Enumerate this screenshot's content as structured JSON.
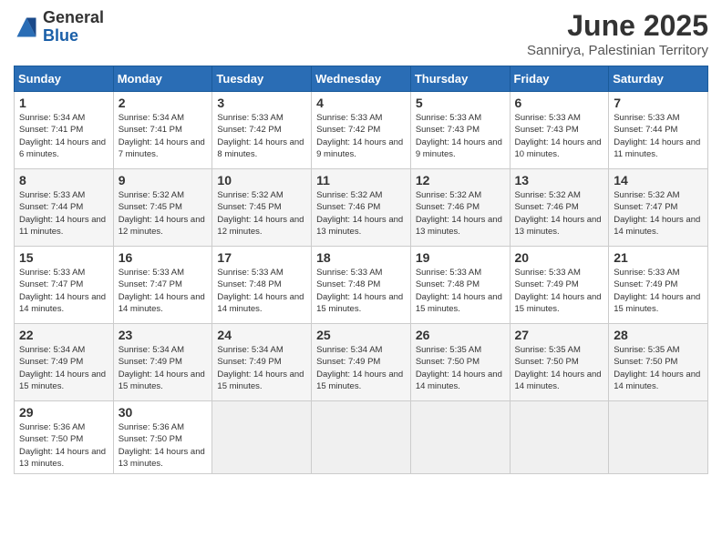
{
  "logo": {
    "general": "General",
    "blue": "Blue"
  },
  "title": "June 2025",
  "subtitle": "Sannirya, Palestinian Territory",
  "days_header": [
    "Sunday",
    "Monday",
    "Tuesday",
    "Wednesday",
    "Thursday",
    "Friday",
    "Saturday"
  ],
  "weeks": [
    [
      {
        "num": "1",
        "sunrise": "5:34 AM",
        "sunset": "7:41 PM",
        "daylight": "14 hours and 6 minutes."
      },
      {
        "num": "2",
        "sunrise": "5:34 AM",
        "sunset": "7:41 PM",
        "daylight": "14 hours and 7 minutes."
      },
      {
        "num": "3",
        "sunrise": "5:33 AM",
        "sunset": "7:42 PM",
        "daylight": "14 hours and 8 minutes."
      },
      {
        "num": "4",
        "sunrise": "5:33 AM",
        "sunset": "7:42 PM",
        "daylight": "14 hours and 9 minutes."
      },
      {
        "num": "5",
        "sunrise": "5:33 AM",
        "sunset": "7:43 PM",
        "daylight": "14 hours and 9 minutes."
      },
      {
        "num": "6",
        "sunrise": "5:33 AM",
        "sunset": "7:43 PM",
        "daylight": "14 hours and 10 minutes."
      },
      {
        "num": "7",
        "sunrise": "5:33 AM",
        "sunset": "7:44 PM",
        "daylight": "14 hours and 11 minutes."
      }
    ],
    [
      {
        "num": "8",
        "sunrise": "5:33 AM",
        "sunset": "7:44 PM",
        "daylight": "14 hours and 11 minutes."
      },
      {
        "num": "9",
        "sunrise": "5:32 AM",
        "sunset": "7:45 PM",
        "daylight": "14 hours and 12 minutes."
      },
      {
        "num": "10",
        "sunrise": "5:32 AM",
        "sunset": "7:45 PM",
        "daylight": "14 hours and 12 minutes."
      },
      {
        "num": "11",
        "sunrise": "5:32 AM",
        "sunset": "7:46 PM",
        "daylight": "14 hours and 13 minutes."
      },
      {
        "num": "12",
        "sunrise": "5:32 AM",
        "sunset": "7:46 PM",
        "daylight": "14 hours and 13 minutes."
      },
      {
        "num": "13",
        "sunrise": "5:32 AM",
        "sunset": "7:46 PM",
        "daylight": "14 hours and 13 minutes."
      },
      {
        "num": "14",
        "sunrise": "5:32 AM",
        "sunset": "7:47 PM",
        "daylight": "14 hours and 14 minutes."
      }
    ],
    [
      {
        "num": "15",
        "sunrise": "5:33 AM",
        "sunset": "7:47 PM",
        "daylight": "14 hours and 14 minutes."
      },
      {
        "num": "16",
        "sunrise": "5:33 AM",
        "sunset": "7:47 PM",
        "daylight": "14 hours and 14 minutes."
      },
      {
        "num": "17",
        "sunrise": "5:33 AM",
        "sunset": "7:48 PM",
        "daylight": "14 hours and 14 minutes."
      },
      {
        "num": "18",
        "sunrise": "5:33 AM",
        "sunset": "7:48 PM",
        "daylight": "14 hours and 15 minutes."
      },
      {
        "num": "19",
        "sunrise": "5:33 AM",
        "sunset": "7:48 PM",
        "daylight": "14 hours and 15 minutes."
      },
      {
        "num": "20",
        "sunrise": "5:33 AM",
        "sunset": "7:49 PM",
        "daylight": "14 hours and 15 minutes."
      },
      {
        "num": "21",
        "sunrise": "5:33 AM",
        "sunset": "7:49 PM",
        "daylight": "14 hours and 15 minutes."
      }
    ],
    [
      {
        "num": "22",
        "sunrise": "5:34 AM",
        "sunset": "7:49 PM",
        "daylight": "14 hours and 15 minutes."
      },
      {
        "num": "23",
        "sunrise": "5:34 AM",
        "sunset": "7:49 PM",
        "daylight": "14 hours and 15 minutes."
      },
      {
        "num": "24",
        "sunrise": "5:34 AM",
        "sunset": "7:49 PM",
        "daylight": "14 hours and 15 minutes."
      },
      {
        "num": "25",
        "sunrise": "5:34 AM",
        "sunset": "7:49 PM",
        "daylight": "14 hours and 15 minutes."
      },
      {
        "num": "26",
        "sunrise": "5:35 AM",
        "sunset": "7:50 PM",
        "daylight": "14 hours and 14 minutes."
      },
      {
        "num": "27",
        "sunrise": "5:35 AM",
        "sunset": "7:50 PM",
        "daylight": "14 hours and 14 minutes."
      },
      {
        "num": "28",
        "sunrise": "5:35 AM",
        "sunset": "7:50 PM",
        "daylight": "14 hours and 14 minutes."
      }
    ],
    [
      {
        "num": "29",
        "sunrise": "5:36 AM",
        "sunset": "7:50 PM",
        "daylight": "14 hours and 13 minutes."
      },
      {
        "num": "30",
        "sunrise": "5:36 AM",
        "sunset": "7:50 PM",
        "daylight": "14 hours and 13 minutes."
      },
      null,
      null,
      null,
      null,
      null
    ]
  ]
}
